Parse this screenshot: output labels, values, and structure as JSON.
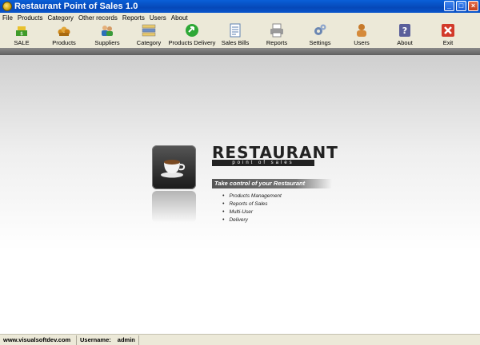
{
  "window": {
    "title": "Restaurant Point of Sales 1.0",
    "app_icon": "pos-app-icon",
    "controls": [
      "minimize",
      "maximize",
      "close"
    ]
  },
  "menu": [
    "File",
    "Products",
    "Category",
    "Other records",
    "Reports",
    "Users",
    "About"
  ],
  "toolbar": [
    {
      "label": "SALE",
      "icon": "sale-icon",
      "color": "#3f9b2a"
    },
    {
      "label": "Products",
      "icon": "products-icon",
      "color": "#d08a1a"
    },
    {
      "label": "Suppliers",
      "icon": "suppliers-icon",
      "color": "#2d6fb8"
    },
    {
      "label": "Category",
      "icon": "category-icon",
      "color": "#6c8fc8"
    },
    {
      "label": "Products Delivery",
      "icon": "delivery-icon",
      "color": "#2ea836"
    },
    {
      "label": "Sales Bills",
      "icon": "sales-bills-icon",
      "color": "#5b7fb0"
    },
    {
      "label": "Reports",
      "icon": "reports-icon",
      "color": "#8a8a8a"
    },
    {
      "label": "Settings",
      "icon": "settings-icon",
      "color": "#6a86b2"
    },
    {
      "label": "Users",
      "icon": "users-icon",
      "color": "#c77a2a"
    },
    {
      "label": "About",
      "icon": "about-icon",
      "color": "#5a5f9a"
    },
    {
      "label": "Exit",
      "icon": "exit-icon",
      "color": "#d23a2a"
    }
  ],
  "splash": {
    "brand_title": "RESTAURANT",
    "brand_subtitle": "point of sales",
    "tagline": "Take control of your Restaurant",
    "features": [
      "Products Management",
      "Reports of Sales",
      "Multi-User",
      "Delivery"
    ]
  },
  "status": {
    "website": "www.visualsoftdev.com",
    "username_label": "Username:",
    "username": "admin"
  }
}
